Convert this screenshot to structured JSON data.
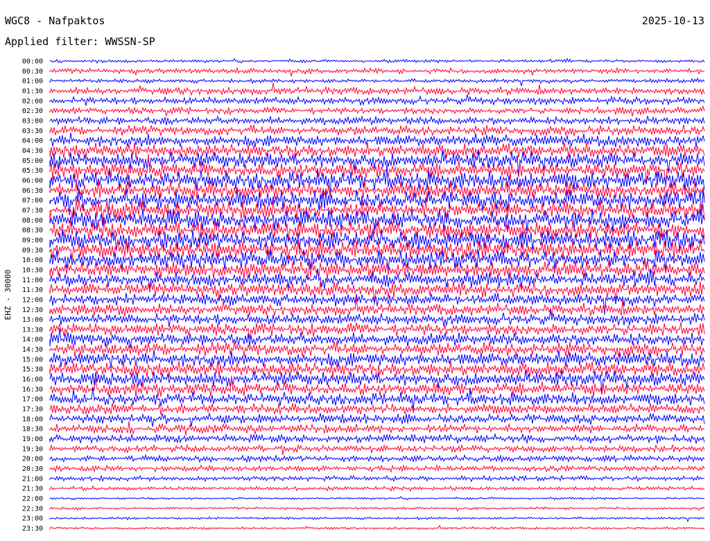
{
  "header": {
    "station": "WGC8 - Nafpaktos",
    "date": "2025-10-13",
    "filter": "Applied filter: WWSSN-SP"
  },
  "chart_data": {
    "type": "helicorder",
    "ylabel": "EHZ - 30000",
    "colors": {
      "a": "#0000ff",
      "b": "#ff0033"
    },
    "rows": [
      {
        "label": "00:00",
        "amp": 0.2
      },
      {
        "label": "00:30",
        "amp": 0.3
      },
      {
        "label": "01:00",
        "amp": 0.25
      },
      {
        "label": "01:30",
        "amp": 0.45
      },
      {
        "label": "02:00",
        "amp": 0.45
      },
      {
        "label": "02:30",
        "amp": 0.4
      },
      {
        "label": "03:00",
        "amp": 0.5
      },
      {
        "label": "03:30",
        "amp": 0.6
      },
      {
        "label": "04:00",
        "amp": 0.75
      },
      {
        "label": "04:30",
        "amp": 0.85
      },
      {
        "label": "05:00",
        "amp": 1.0
      },
      {
        "label": "05:30",
        "amp": 1.05
      },
      {
        "label": "06:00",
        "amp": 1.1
      },
      {
        "label": "06:30",
        "amp": 1.1
      },
      {
        "label": "07:00",
        "amp": 1.15
      },
      {
        "label": "07:30",
        "amp": 1.15
      },
      {
        "label": "08:00",
        "amp": 1.2
      },
      {
        "label": "08:30",
        "amp": 1.2
      },
      {
        "label": "09:00",
        "amp": 1.2
      },
      {
        "label": "09:30",
        "amp": 1.15
      },
      {
        "label": "10:00",
        "amp": 1.1
      },
      {
        "label": "10:30",
        "amp": 1.05
      },
      {
        "label": "11:00",
        "amp": 0.95
      },
      {
        "label": "11:30",
        "amp": 0.85
      },
      {
        "label": "12:00",
        "amp": 0.75
      },
      {
        "label": "12:30",
        "amp": 0.7
      },
      {
        "label": "13:00",
        "amp": 0.7
      },
      {
        "label": "13:30",
        "amp": 0.75
      },
      {
        "label": "14:00",
        "amp": 0.8
      },
      {
        "label": "14:30",
        "amp": 0.85
      },
      {
        "label": "15:00",
        "amp": 0.9
      },
      {
        "label": "15:30",
        "amp": 0.9
      },
      {
        "label": "16:00",
        "amp": 0.9
      },
      {
        "label": "16:30",
        "amp": 0.85
      },
      {
        "label": "17:00",
        "amp": 0.75
      },
      {
        "label": "17:30",
        "amp": 0.65
      },
      {
        "label": "18:00",
        "amp": 0.6
      },
      {
        "label": "18:30",
        "amp": 0.55
      },
      {
        "label": "19:00",
        "amp": 0.5
      },
      {
        "label": "19:30",
        "amp": 0.45
      },
      {
        "label": "20:00",
        "amp": 0.4
      },
      {
        "label": "20:30",
        "amp": 0.35
      },
      {
        "label": "21:00",
        "amp": 0.3
      },
      {
        "label": "21:30",
        "amp": 0.25
      },
      {
        "label": "22:00",
        "amp": 0.15
      },
      {
        "label": "22:30",
        "amp": 0.15
      },
      {
        "label": "23:00",
        "amp": 0.15
      },
      {
        "label": "23:30",
        "amp": 0.15
      }
    ]
  }
}
